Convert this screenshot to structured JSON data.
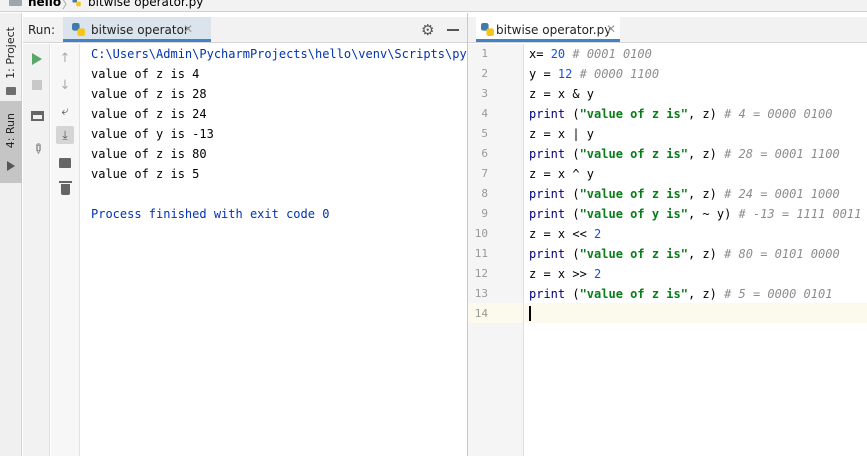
{
  "breadcrumb": {
    "project": "hello",
    "file": "bitwise operator.py"
  },
  "left_stripe": {
    "project_tab": "1: Project",
    "run_tab": "4: Run"
  },
  "run_window": {
    "label": "Run:",
    "tab_title": "bitwise operator",
    "console_lines": [
      "C:\\Users\\Admin\\PycharmProjects\\hello\\venv\\Scripts\\python.exe",
      "value of z is 4",
      "value of z is 28",
      "value of z is 24",
      "value of y is -13",
      "value of z is 80",
      "value of z is 5",
      "",
      "Process finished with exit code 0"
    ]
  },
  "editor": {
    "tab_title": "bitwise operator.py",
    "line_numbers": [
      "1",
      "2",
      "3",
      "4",
      "5",
      "6",
      "7",
      "8",
      "9",
      "10",
      "11",
      "12",
      "13",
      "14"
    ],
    "lines": [
      {
        "code": "x= ",
        "num": "20",
        "rest": "",
        "comment": " # 0001 0100"
      },
      {
        "code": "y = ",
        "num": "12",
        "rest": "",
        "comment": " # 0000 1100"
      },
      {
        "code": "z = x & y",
        "num": "",
        "rest": "",
        "comment": ""
      },
      {
        "fn": "print",
        "pre": " (",
        "str": "\"value of z is\"",
        "post": ", z)",
        "comment": " # 4 = 0000 0100"
      },
      {
        "code": "z = x | y",
        "num": "",
        "rest": "",
        "comment": ""
      },
      {
        "fn": "print",
        "pre": " (",
        "str": "\"value of z is\"",
        "post": ", z)",
        "comment": " # 28 = 0001 1100"
      },
      {
        "code": "z = x ^ y",
        "num": "",
        "rest": "",
        "comment": ""
      },
      {
        "fn": "print",
        "pre": " (",
        "str": "\"value of z is\"",
        "post": ", z)",
        "comment": " # 24 = 0001 1000"
      },
      {
        "fn": "print",
        "pre": " (",
        "str": "\"value of y is\"",
        "post": ", ~ y)",
        "comment": " # -13 = 1111 0011"
      },
      {
        "code": "z = x << ",
        "num": "2",
        "rest": "",
        "comment": ""
      },
      {
        "fn": "print",
        "pre": " (",
        "str": "\"value of z is\"",
        "post": ", z)",
        "comment": " # 80 = 0101 0000"
      },
      {
        "code": "z = x >> ",
        "num": "2",
        "rest": "",
        "comment": ""
      },
      {
        "fn": "print",
        "pre": " (",
        "str": "\"value of z is\"",
        "post": ", z)",
        "comment": " # 5 = 0000 0101"
      },
      {
        "code": "",
        "num": "",
        "rest": "",
        "comment": ""
      }
    ]
  },
  "colors": {
    "accent": "#4083c9",
    "run_green": "#59a869",
    "string_green": "#067d17",
    "number_blue": "#1750eb",
    "comment_gray": "#8c8c8c",
    "console_blue": "#0033b3"
  }
}
